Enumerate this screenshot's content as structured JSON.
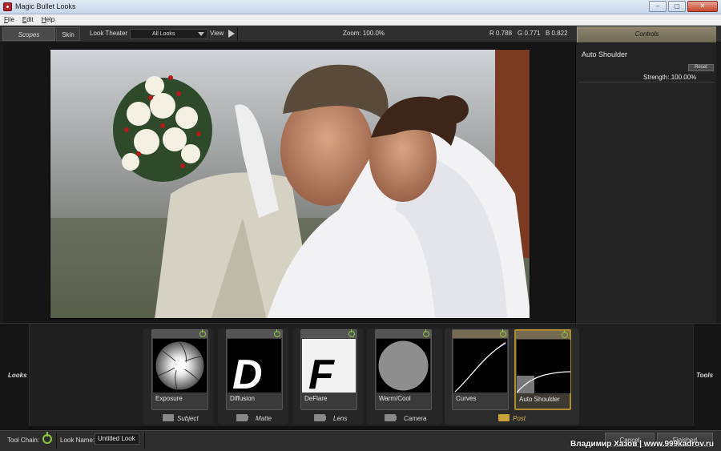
{
  "window": {
    "title": "Magic Bullet Looks",
    "buttons": [
      "–",
      "▢",
      "✕"
    ]
  },
  "menu": [
    {
      "ul": "F",
      "rest": "ile"
    },
    {
      "ul": "E",
      "rest": "dit"
    },
    {
      "ul": "H",
      "rest": "elp"
    }
  ],
  "toolbar": {
    "scopes": "Scopes",
    "skin": "Skin",
    "look_theater": "Look Theater",
    "looks_select": "All Looks",
    "view": "View",
    "zoom": "Zoom:  100.0%",
    "r": "R  0.788",
    "g": "G  0.771",
    "b": "B  0.822"
  },
  "controls": {
    "header": "Controls",
    "tool_name": "Auto Shoulder",
    "reset": "Reset",
    "strength": "Strength: 100.00%"
  },
  "side_labels": {
    "left": "Looks",
    "right": "Tools"
  },
  "tools": [
    {
      "label": "Exposure",
      "icon": "aperture-icon"
    },
    {
      "label": "Diffusion",
      "icon": "diffusion-d-icon"
    },
    {
      "label": "DeFlare",
      "icon": "deflare-f-icon"
    },
    {
      "label": "Warm/Cool",
      "icon": "warm-cool-circle-icon"
    },
    {
      "label": "Curves",
      "icon": "curves-graph-icon"
    },
    {
      "label": "Auto Shoulder",
      "icon": "auto-shoulder-graph-icon"
    }
  ],
  "categories": [
    "Subject",
    "Matte",
    "Lens",
    "Camera",
    "Post"
  ],
  "bottom": {
    "tool_chain": "Tool Chain:",
    "look_name_label": "Look Name:",
    "look_name_value": "Untitled Look",
    "cancel": "Cancel",
    "finished": "Finished",
    "watermark": "Владимир Хазов | www.999kadrov.ru"
  },
  "colors": {
    "panel": "#2f2f2f",
    "active_tool_border": "#b08a2e",
    "power_green": "#8dc63f",
    "post_accent": "#e0b84a"
  }
}
